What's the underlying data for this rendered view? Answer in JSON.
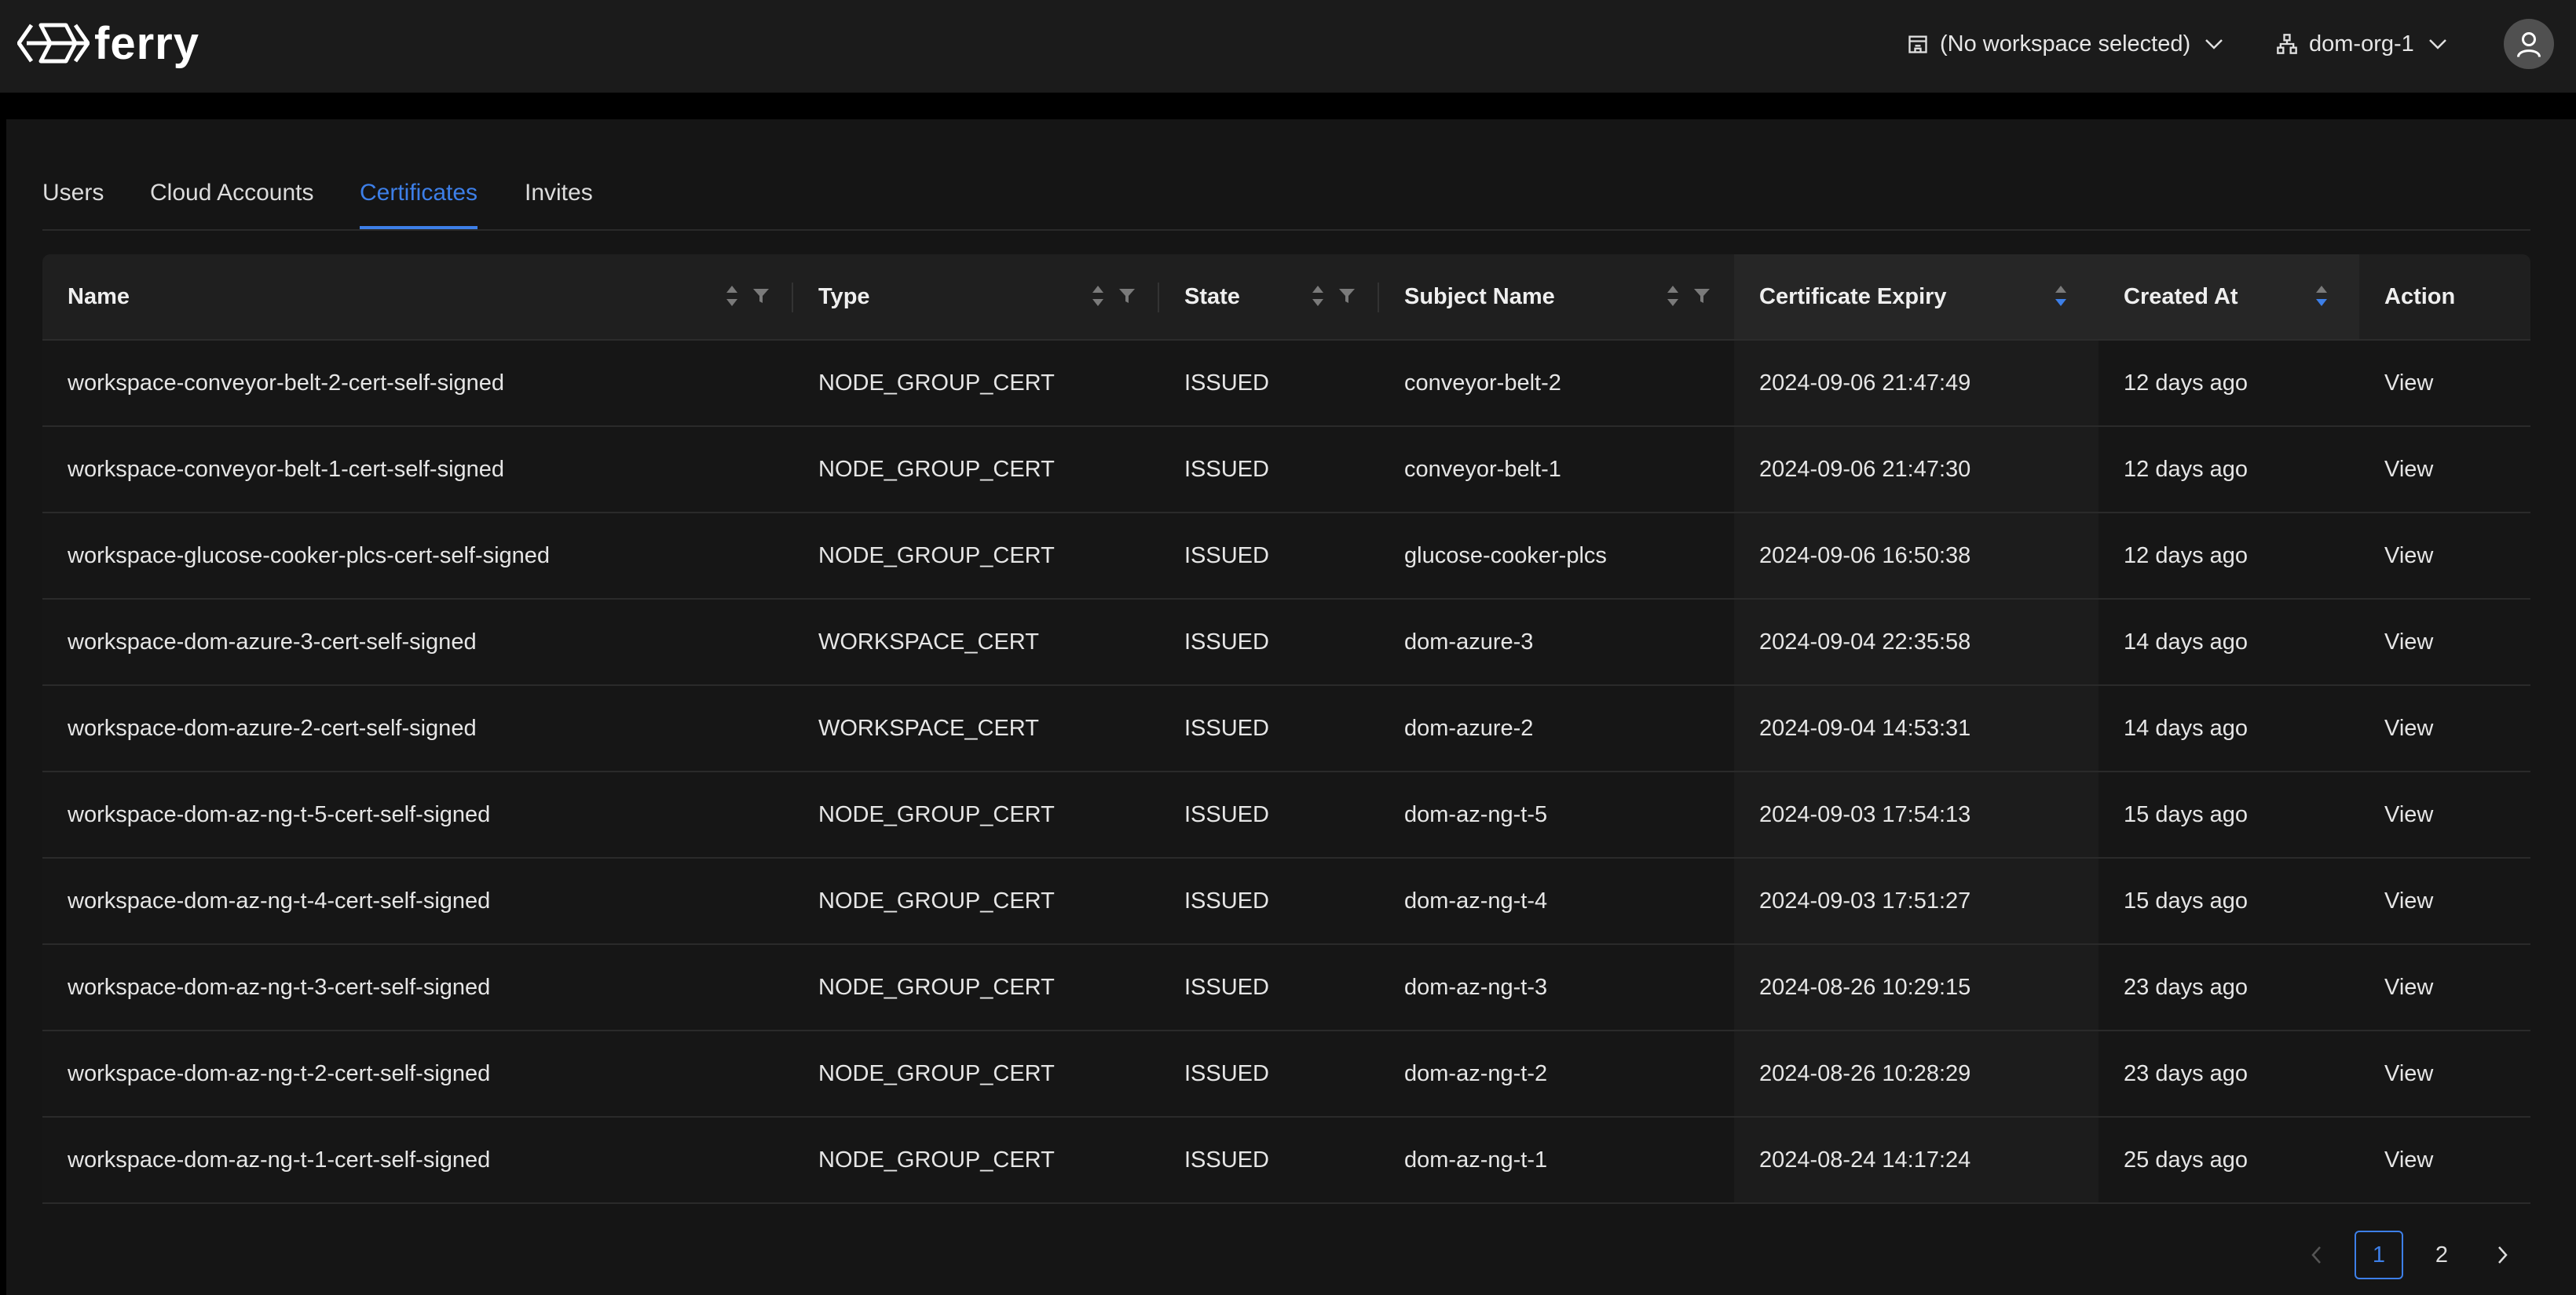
{
  "header": {
    "app_name": "ferry",
    "workspace_label": "(No workspace selected)",
    "org_label": "dom-org-1"
  },
  "tabs": [
    {
      "label": "Users"
    },
    {
      "label": "Cloud Accounts"
    },
    {
      "label": "Certificates",
      "active": true
    },
    {
      "label": "Invites"
    }
  ],
  "table": {
    "columns": [
      "Name",
      "Type",
      "State",
      "Subject Name",
      "Certificate Expiry",
      "Created At",
      "Action"
    ],
    "rows": [
      {
        "name": "workspace-conveyor-belt-2-cert-self-signed",
        "type": "NODE_GROUP_CERT",
        "state": "ISSUED",
        "subject": "conveyor-belt-2",
        "expiry": "2024-09-06 21:47:49",
        "created": "12 days ago",
        "action": "View"
      },
      {
        "name": "workspace-conveyor-belt-1-cert-self-signed",
        "type": "NODE_GROUP_CERT",
        "state": "ISSUED",
        "subject": "conveyor-belt-1",
        "expiry": "2024-09-06 21:47:30",
        "created": "12 days ago",
        "action": "View"
      },
      {
        "name": "workspace-glucose-cooker-plcs-cert-self-signed",
        "type": "NODE_GROUP_CERT",
        "state": "ISSUED",
        "subject": "glucose-cooker-plcs",
        "expiry": "2024-09-06 16:50:38",
        "created": "12 days ago",
        "action": "View"
      },
      {
        "name": "workspace-dom-azure-3-cert-self-signed",
        "type": "WORKSPACE_CERT",
        "state": "ISSUED",
        "subject": "dom-azure-3",
        "expiry": "2024-09-04 22:35:58",
        "created": "14 days ago",
        "action": "View"
      },
      {
        "name": "workspace-dom-azure-2-cert-self-signed",
        "type": "WORKSPACE_CERT",
        "state": "ISSUED",
        "subject": "dom-azure-2",
        "expiry": "2024-09-04 14:53:31",
        "created": "14 days ago",
        "action": "View"
      },
      {
        "name": "workspace-dom-az-ng-t-5-cert-self-signed",
        "type": "NODE_GROUP_CERT",
        "state": "ISSUED",
        "subject": "dom-az-ng-t-5",
        "expiry": "2024-09-03 17:54:13",
        "created": "15 days ago",
        "action": "View"
      },
      {
        "name": "workspace-dom-az-ng-t-4-cert-self-signed",
        "type": "NODE_GROUP_CERT",
        "state": "ISSUED",
        "subject": "dom-az-ng-t-4",
        "expiry": "2024-09-03 17:51:27",
        "created": "15 days ago",
        "action": "View"
      },
      {
        "name": "workspace-dom-az-ng-t-3-cert-self-signed",
        "type": "NODE_GROUP_CERT",
        "state": "ISSUED",
        "subject": "dom-az-ng-t-3",
        "expiry": "2024-08-26 10:29:15",
        "created": "23 days ago",
        "action": "View"
      },
      {
        "name": "workspace-dom-az-ng-t-2-cert-self-signed",
        "type": "NODE_GROUP_CERT",
        "state": "ISSUED",
        "subject": "dom-az-ng-t-2",
        "expiry": "2024-08-26 10:28:29",
        "created": "23 days ago",
        "action": "View"
      },
      {
        "name": "workspace-dom-az-ng-t-1-cert-self-signed",
        "type": "NODE_GROUP_CERT",
        "state": "ISSUED",
        "subject": "dom-az-ng-t-1",
        "expiry": "2024-08-24 14:17:24",
        "created": "25 days ago",
        "action": "View"
      }
    ]
  },
  "pagination": {
    "pages": [
      "1",
      "2"
    ],
    "current": "1"
  },
  "colors": {
    "accent": "#3d7fe8",
    "background": "#151515",
    "header_bg": "#1b1b1b"
  },
  "icons": {
    "logo": "ferry-logo-icon",
    "workspace": "building-icon",
    "org": "org-tree-icon",
    "user": "user-avatar-icon",
    "sort": "sort-icon",
    "filter": "filter-icon"
  }
}
